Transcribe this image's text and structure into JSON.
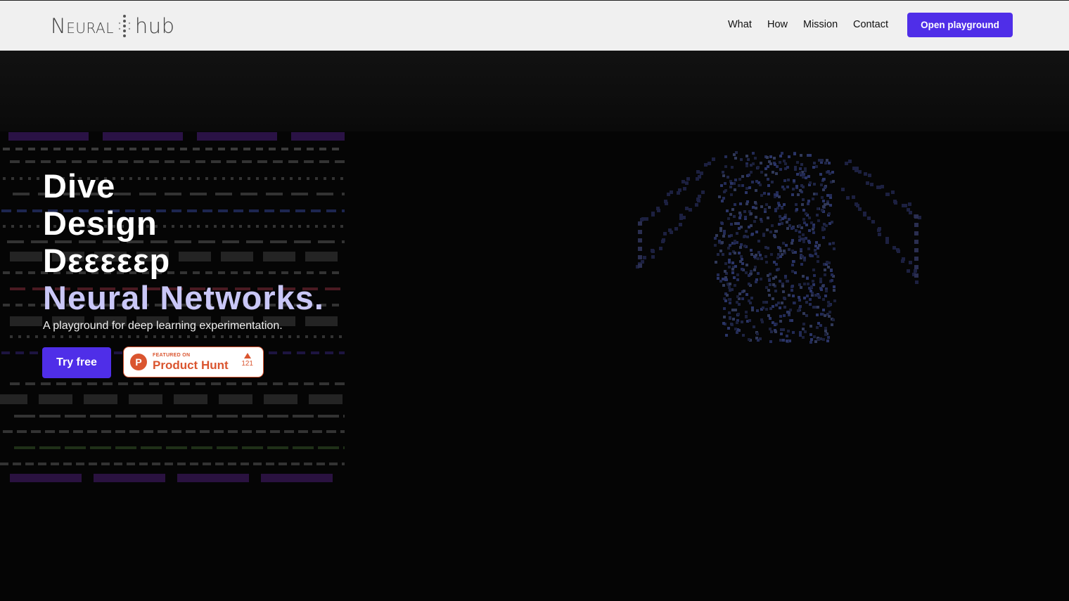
{
  "header": {
    "logo_left": "Neural",
    "logo_right": "hub",
    "nav": [
      {
        "label": "What"
      },
      {
        "label": "How"
      },
      {
        "label": "Mission"
      },
      {
        "label": "Contact"
      }
    ],
    "cta_label": "Open playground"
  },
  "hero": {
    "headline_lines": [
      "Dive",
      "Design",
      "Dεεεεεp",
      "Neural Networks."
    ],
    "subtitle": "A playground for deep learning experimentation.",
    "try_label": "Try free",
    "product_hunt": {
      "featured": "FEATURED ON",
      "name": "Product Hunt",
      "icon_letter": "P",
      "votes": "121"
    }
  },
  "colors": {
    "brand": "#4f2ee8",
    "accent_text": "#c9c7f7",
    "product_hunt": "#da552f",
    "background": "#050505"
  }
}
